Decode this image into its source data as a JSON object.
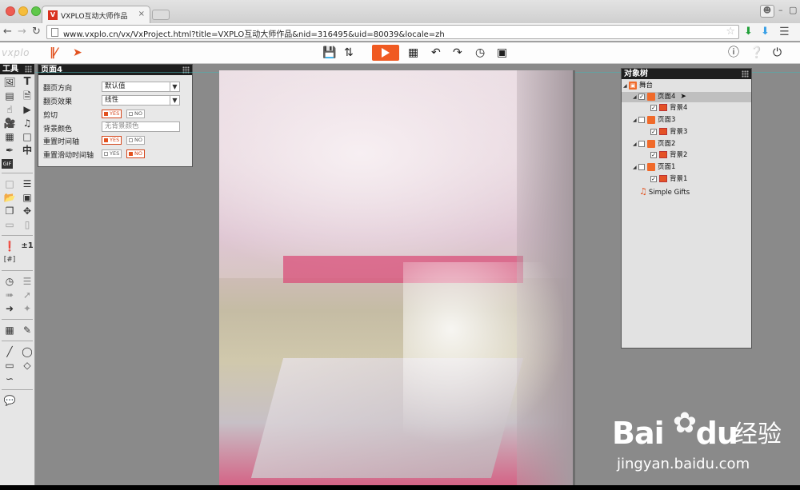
{
  "browser": {
    "tab_title": "VXPLO互动大师作品",
    "tab_favicon": "V",
    "tab_close": "×",
    "url": "www.vxplo.cn/vx/VxProject.html?title=VXPLO互动大师作品&nid=316495&uid=80039&locale=zh",
    "profile_icon": "person-icon"
  },
  "app": {
    "logo": "vxplo",
    "tools_panel_title": "工具",
    "props_panel_title": "页面4",
    "object_tree_title": "对象树"
  },
  "props": {
    "flip_direction_label": "翻页方向",
    "flip_direction_value": "默认值",
    "flip_effect_label": "翻页效果",
    "flip_effect_value": "线性",
    "clip_label": "剪切",
    "bg_color_label": "背景颜色",
    "bg_color_value": "无背景颜色",
    "reset_timeline_label": "重置时间轴",
    "reset_slide_timeline_label": "重置滑动时间轴",
    "yes": "YES",
    "no": "NO"
  },
  "tools_text": {
    "text_tool": "T",
    "chinese_tool": "中",
    "gif_tool": "GIF",
    "plus_minus_tool": "±1"
  },
  "tree": {
    "stage": "舞台",
    "page4": "页面4",
    "bg4": "背景4",
    "page3": "页面3",
    "bg3": "背景3",
    "page2": "页面2",
    "bg2": "背景2",
    "page1": "页面1",
    "bg1": "背景1",
    "music": "Simple Gifts"
  },
  "watermark": {
    "bai": "Bai",
    "du": "du",
    "jingyan": "经验",
    "domain": "jingyan.baidu.com"
  },
  "colors": {
    "play_button": "#f05a22",
    "guide": "#46b3b3",
    "accent_orange": "#e2511e"
  }
}
